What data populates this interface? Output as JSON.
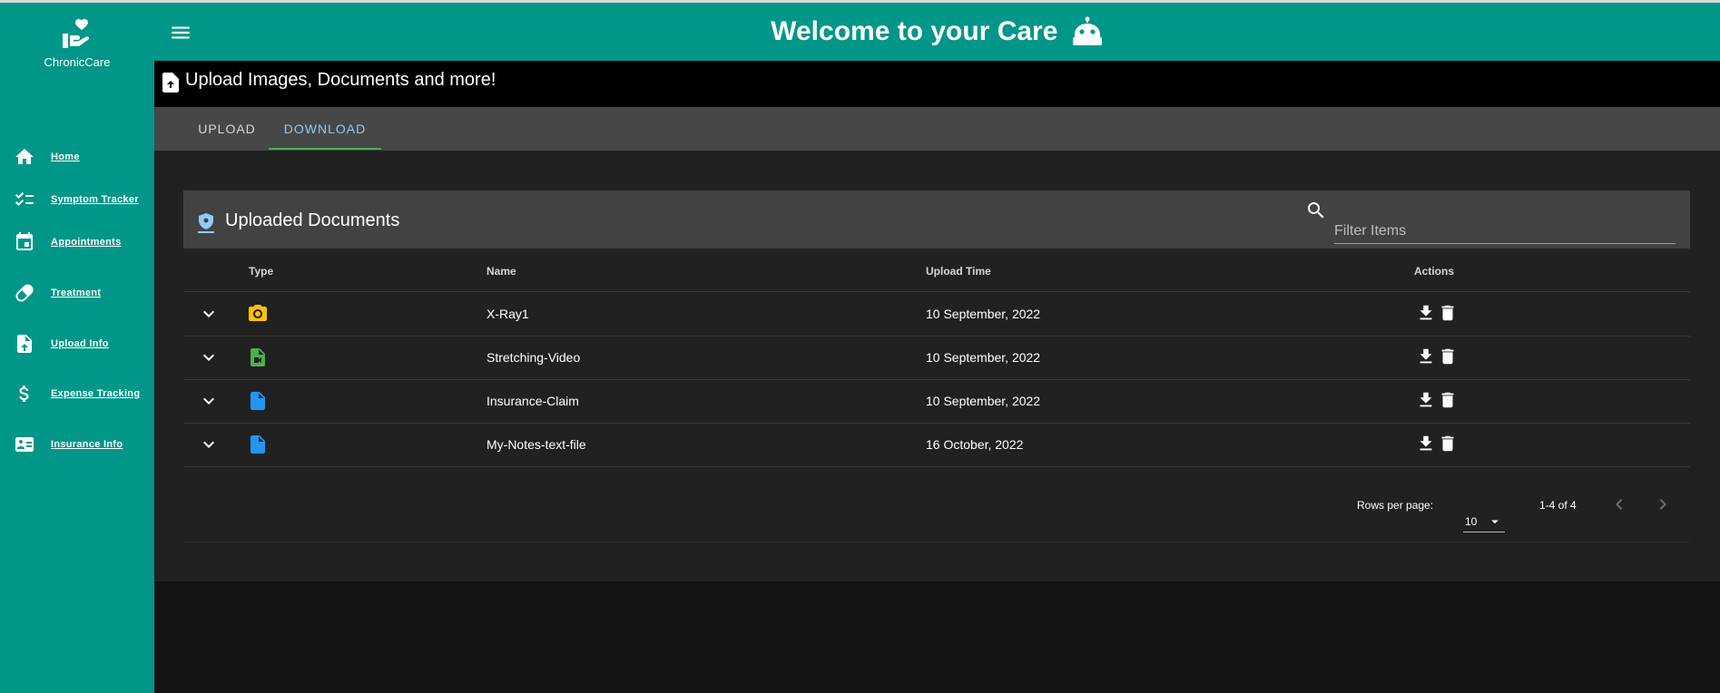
{
  "brand": {
    "name": "ChronicCare"
  },
  "sidebar": {
    "items": [
      {
        "label": "Home",
        "icon": "home-icon"
      },
      {
        "label": "Symptom Tracker",
        "icon": "checklist-icon"
      },
      {
        "label": "Appointments",
        "icon": "calendar-icon"
      },
      {
        "label": "Treatment",
        "icon": "pill-icon"
      },
      {
        "label": "Upload Info",
        "icon": "file-upload-icon"
      },
      {
        "label": "Expense Tracking",
        "icon": "dollar-icon"
      },
      {
        "label": "Insurance Info",
        "icon": "id-card-icon"
      }
    ]
  },
  "header": {
    "title": "Welcome to your Care"
  },
  "banner": {
    "text": "Upload Images, Documents and more!"
  },
  "tabs": {
    "upload": "UPLOAD",
    "download": "DOWNLOAD",
    "active": "DOWNLOAD"
  },
  "table": {
    "title": "Uploaded Documents",
    "filter_placeholder": "Filter Items",
    "columns": {
      "type": "Type",
      "name": "Name",
      "time": "Upload Time",
      "actions": "Actions"
    },
    "rows": [
      {
        "type": "image",
        "name": "X-Ray1",
        "time": "10 September, 2022"
      },
      {
        "type": "video",
        "name": "Stretching-Video",
        "time": "10 September, 2022"
      },
      {
        "type": "document",
        "name": "Insurance-Claim",
        "time": "10 September, 2022"
      },
      {
        "type": "document",
        "name": "My-Notes-text-file",
        "time": "16 October, 2022"
      }
    ],
    "pagination": {
      "rows_per_page_label": "Rows per page:",
      "rows_per_page": "10",
      "range": "1-4 of 4"
    }
  },
  "colors": {
    "primary": "#009688",
    "image_icon": "#ffc107",
    "video_icon": "#4caf50",
    "document_icon": "#2196f3",
    "tab_active": "#90caf9",
    "tab_indicator": "#4caf50"
  }
}
